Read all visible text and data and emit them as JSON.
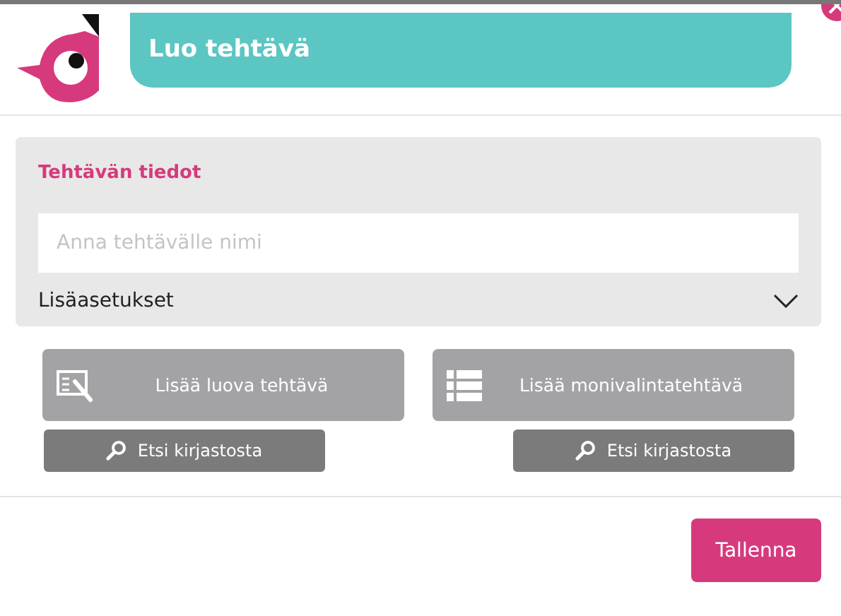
{
  "header": {
    "title": "Luo tehtävä"
  },
  "panel": {
    "title": "Tehtävän tiedot",
    "name_field": {
      "placeholder": "Anna tehtävälle nimi"
    },
    "advanced": {
      "label": "Lisäasetukset",
      "expanded": false
    }
  },
  "actions": [
    {
      "kind": "creative",
      "label": "Lisää luova tehtävä",
      "search": "Etsi kirjastosta"
    },
    {
      "kind": "multichoice",
      "label": "Lisää monivalintatehtävä",
      "search": "Etsi kirjastosta"
    }
  ],
  "save_button": "Tallenna"
}
